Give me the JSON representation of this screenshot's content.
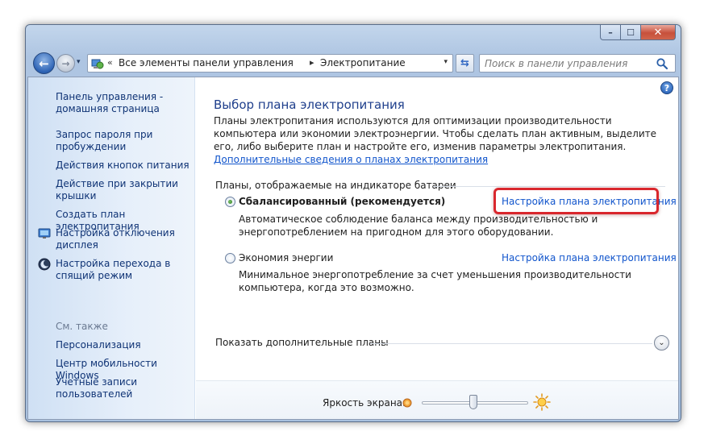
{
  "window": {
    "caption_minimize": "–",
    "caption_maximize": "☐",
    "caption_close": "✕"
  },
  "navigation": {
    "back_glyph": "←",
    "forward_glyph": "→",
    "history_glyph": "▾",
    "breadcrumb_sep_1": "«",
    "breadcrumb_1": "Все элементы панели управления",
    "breadcrumb_sep_2": "▸",
    "breadcrumb_2": "Электропитание",
    "dropdown_glyph": "▾",
    "refresh_glyph": "⇆",
    "search_placeholder": "Поиск в панели управления"
  },
  "sidebar": {
    "home_link": "Панель управления - домашняя страница",
    "items": [
      "Запрос пароля при пробуждении",
      "Действия кнопок питания",
      "Действие при закрытии крышки",
      "Создать план электропитания",
      "Настройка отключения дисплея",
      "Настройка перехода в спящий режим"
    ],
    "see_also_heading": "См. также",
    "see_also": [
      "Персонализация",
      "Центр мобильности Windows",
      "Учетные записи пользователей"
    ]
  },
  "main": {
    "help_glyph": "?",
    "title": "Выбор плана электропитания",
    "intro_text": "Планы электропитания используются для оптимизации производительности компьютера или экономии электроэнергии. Чтобы сделать план активным, выделите его, либо выберите план и настройте его, изменив параметры электропитания. ",
    "intro_link": "Дополнительные сведения о планах электропитания",
    "group_label": "Планы, отображаемые на индикаторе батареи",
    "plans": [
      {
        "name": "Сбалансированный (рекомендуется)",
        "description": "Автоматическое соблюдение баланса между производительностью и энергопотреблением на пригодном для этого оборудовании.",
        "link": "Настройка плана электропитания",
        "selected": true
      },
      {
        "name": "Экономия энергии",
        "description": "Минимальное энергопотребление за счет уменьшения производительности компьютера, когда это возможно.",
        "link": "Настройка плана электропитания",
        "selected": false
      }
    ],
    "more_plans": "Показать дополнительные планы",
    "expand_glyph": "⌄",
    "brightness_label": "Яркость экрана:",
    "brightness_level_percent": 48
  },
  "colors": {
    "link": "#1155cc",
    "title": "#1f3f8c",
    "highlight": "#d9272d",
    "sidebar_link": "#0f3375"
  },
  "icons": {
    "address": "control-panel-icon",
    "search": "magnifier-icon",
    "display": "monitor-icon",
    "sleep": "moon-icon",
    "brightness_low": "sun-small-icon",
    "brightness_high": "sun-large-icon"
  }
}
